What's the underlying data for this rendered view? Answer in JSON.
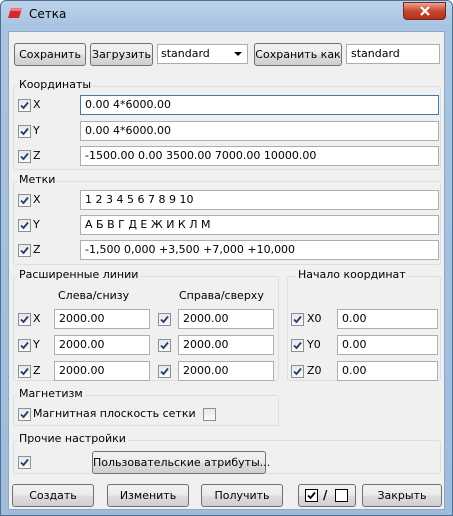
{
  "window": {
    "title": "Сетка"
  },
  "top": {
    "save": "Сохранить",
    "load": "Загрузить",
    "preset": "standard",
    "save_as": "Сохранить как",
    "save_as_name": "standard"
  },
  "coords": {
    "title": "Координаты",
    "x_label": "X",
    "x_value": "0.00 4*6000.00",
    "y_label": "Y",
    "y_value": "0.00 4*6000.00",
    "z_label": "Z",
    "z_value": "-1500.00 0.00 3500.00 7000.00 10000.00"
  },
  "labels": {
    "title": "Метки",
    "x_label": "X",
    "x_value": "1 2 3 4 5 6 7 8 9 10",
    "y_label": "Y",
    "y_value": "А Б В Г Д Е Ж И К Л М",
    "z_label": "Z",
    "z_value": "-1,500 0,000 +3,500 +7,000 +10,000"
  },
  "ext": {
    "title": "Расширенные линии",
    "col_left": "Слева/снизу",
    "col_right": "Справа/сверху",
    "rows": [
      {
        "label": "X",
        "left": "2000.00",
        "right": "2000.00"
      },
      {
        "label": "Y",
        "left": "2000.00",
        "right": "2000.00"
      },
      {
        "label": "Z",
        "left": "2000.00",
        "right": "2000.00"
      }
    ]
  },
  "origin": {
    "title": "Начало координат",
    "rows": [
      {
        "label": "X0",
        "value": "0.00"
      },
      {
        "label": "Y0",
        "value": "0.00"
      },
      {
        "label": "Z0",
        "value": "0.00"
      }
    ]
  },
  "magnet": {
    "title": "Магнетизм",
    "plane_label": "Магнитная плоскость сетки"
  },
  "other": {
    "title": "Прочие настройки",
    "user_attrs": "Пользовательские атрибуты..."
  },
  "bottom": {
    "create": "Создать",
    "modify": "Изменить",
    "get": "Получить",
    "toggle_sep": "/",
    "close": "Закрыть"
  },
  "colors": {
    "title_bar": "#a9c4e2",
    "close": "#c7452e",
    "focus": "#3d7bad"
  }
}
